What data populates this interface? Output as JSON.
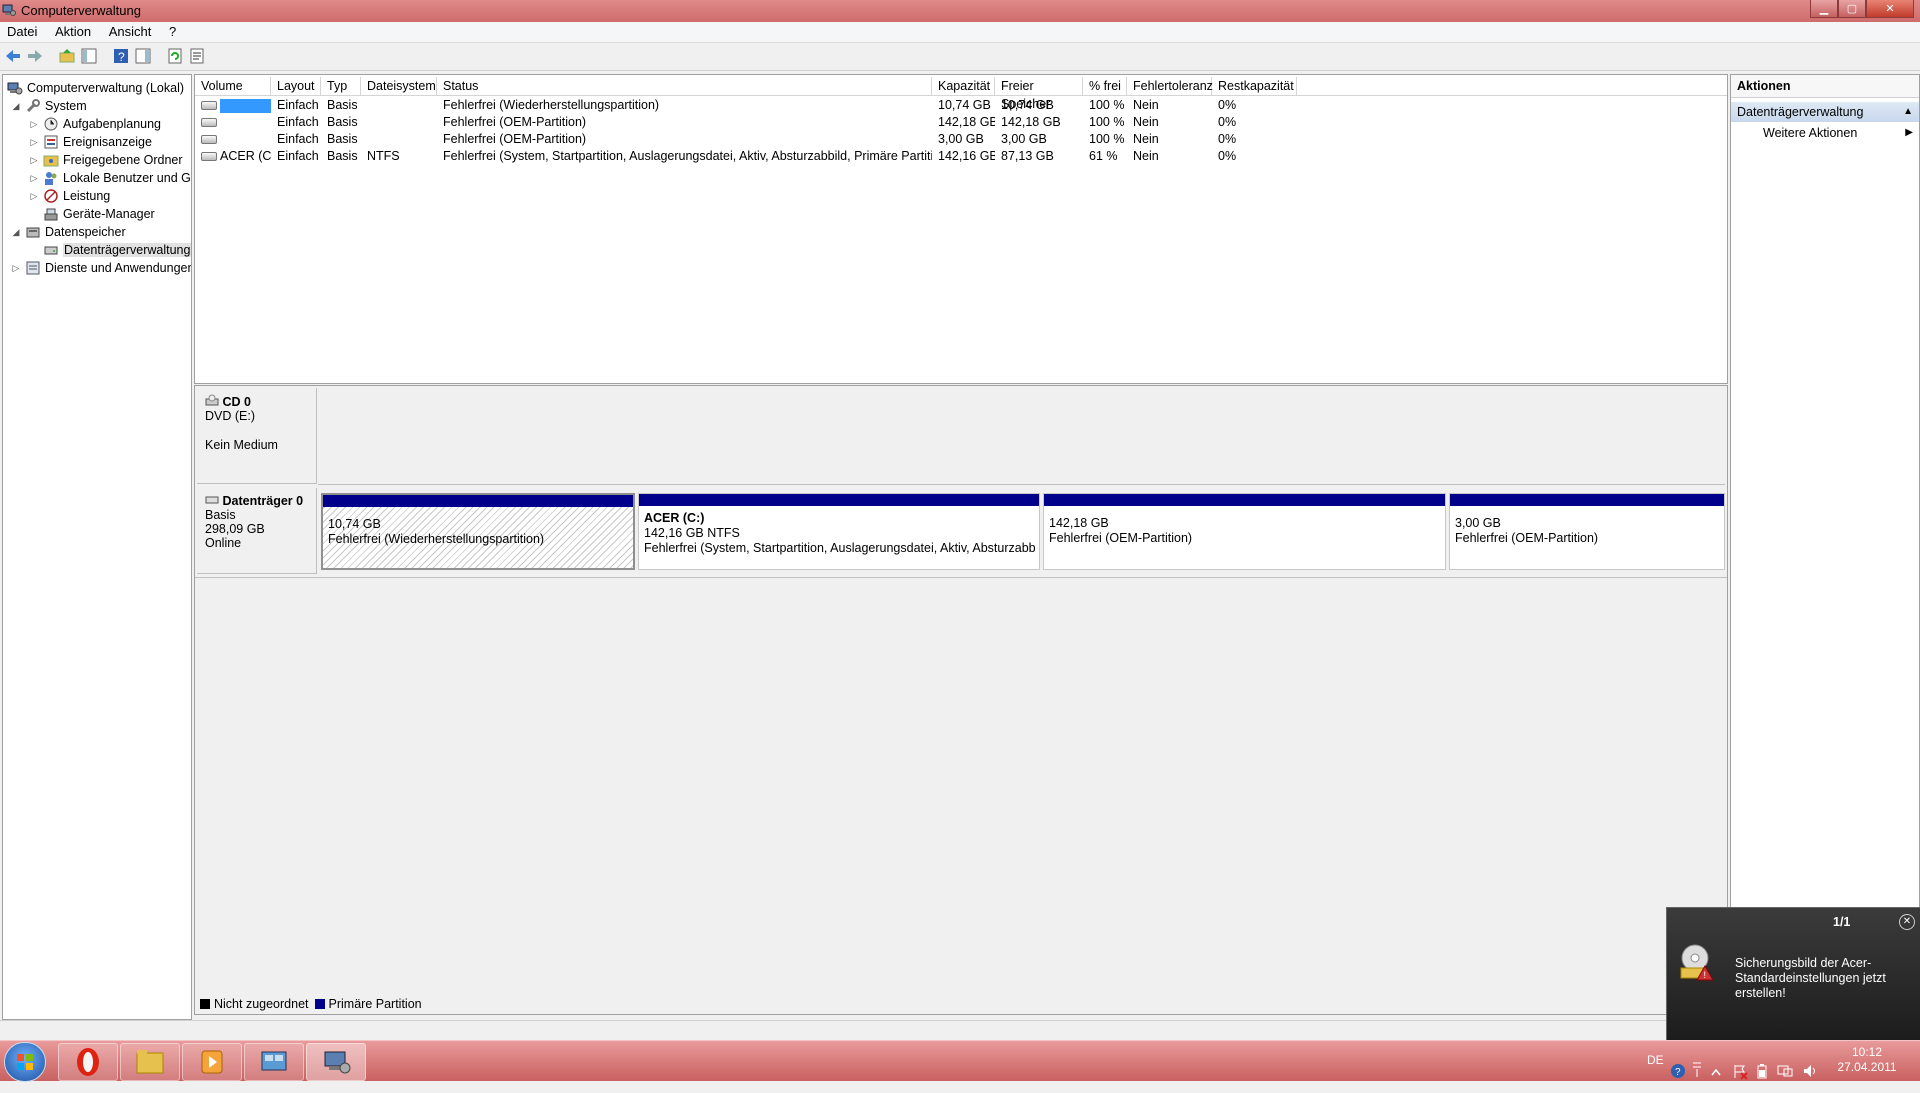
{
  "window": {
    "title": "Computerverwaltung"
  },
  "menu": [
    "Datei",
    "Aktion",
    "Ansicht",
    "?"
  ],
  "tree": [
    {
      "label": "Computerverwaltung (Lokal)",
      "icon": "computer-icon",
      "level": 0,
      "expander": ""
    },
    {
      "label": "System",
      "icon": "tools-icon",
      "level": 1,
      "expander": "◢"
    },
    {
      "label": "Aufgabenplanung",
      "icon": "clock-icon",
      "level": 2,
      "expander": "▷"
    },
    {
      "label": "Ereignisanzeige",
      "icon": "event-viewer-icon",
      "level": 2,
      "expander": "▷"
    },
    {
      "label": "Freigegebene Ordner",
      "icon": "shared-folder-icon",
      "level": 2,
      "expander": "▷"
    },
    {
      "label": "Lokale Benutzer und Gr",
      "icon": "users-icon",
      "level": 2,
      "expander": "▷"
    },
    {
      "label": "Leistung",
      "icon": "performance-icon",
      "level": 2,
      "expander": "▷"
    },
    {
      "label": "Geräte-Manager",
      "icon": "device-manager-icon",
      "level": 2,
      "expander": ""
    },
    {
      "label": "Datenspeicher",
      "icon": "storage-icon",
      "level": 1,
      "expander": "◢"
    },
    {
      "label": "Datenträgerverwaltung",
      "icon": "disk-management-icon",
      "level": 2,
      "expander": "",
      "selected": true
    },
    {
      "label": "Dienste und Anwendungen",
      "icon": "services-icon",
      "level": 1,
      "expander": "▷"
    }
  ],
  "volume_columns": [
    "Volume",
    "Layout",
    "Typ",
    "Dateisystem",
    "Status",
    "Kapazität",
    "Freier Speicher",
    "% frei",
    "Fehlertoleranz",
    "Restkapazität"
  ],
  "volumes": [
    {
      "volume": "",
      "selected": true,
      "layout": "Einfach",
      "typ": "Basis",
      "fs": "",
      "status": "Fehlerfrei (Wiederherstellungspartition)",
      "cap": "10,74 GB",
      "free": "10,74 GB",
      "pct": "100 %",
      "ft": "Nein",
      "rest": "0%"
    },
    {
      "volume": "",
      "layout": "Einfach",
      "typ": "Basis",
      "fs": "",
      "status": "Fehlerfrei (OEM-Partition)",
      "cap": "142,18 GB",
      "free": "142,18 GB",
      "pct": "100 %",
      "ft": "Nein",
      "rest": "0%"
    },
    {
      "volume": "",
      "layout": "Einfach",
      "typ": "Basis",
      "fs": "",
      "status": "Fehlerfrei (OEM-Partition)",
      "cap": "3,00 GB",
      "free": "3,00 GB",
      "pct": "100 %",
      "ft": "Nein",
      "rest": "0%"
    },
    {
      "volume": "ACER (C:)",
      "layout": "Einfach",
      "typ": "Basis",
      "fs": "NTFS",
      "status": "Fehlerfrei (System, Startpartition, Auslagerungsdatei, Aktiv, Absturzabbild, Primäre Partition)",
      "cap": "142,16 GB",
      "free": "87,13 GB",
      "pct": "61 %",
      "ft": "Nein",
      "rest": "0%"
    }
  ],
  "cd0": {
    "name": "CD 0",
    "drive": "DVD (E:)",
    "medium": "Kein Medium"
  },
  "disk0": {
    "name": "Datenträger 0",
    "type": "Basis",
    "size": "298,09 GB",
    "state": "Online",
    "partitions": [
      {
        "title": "",
        "size": "10,74 GB",
        "status": "Fehlerfrei (Wiederherstellungspartition)",
        "hatched": true
      },
      {
        "title": "ACER  (C:)",
        "size": "142,16 GB NTFS",
        "status": "Fehlerfrei (System, Startpartition, Auslagerungsdatei, Aktiv, Absturzabbild,"
      },
      {
        "title": "",
        "size": "142,18 GB",
        "status": "Fehlerfrei (OEM-Partition)"
      },
      {
        "title": "",
        "size": "3,00 GB",
        "status": "Fehlerfrei (OEM-Partition)"
      }
    ]
  },
  "legend": {
    "unallocated": "Nicht zugeordnet",
    "primary": "Primäre Partition",
    "unallocated_color": "#000000",
    "primary_color": "#00008b"
  },
  "actions": {
    "header": "Aktionen",
    "section": "Datenträgerverwaltung",
    "more": "Weitere Aktionen"
  },
  "notification": {
    "count": "1/1",
    "message": "Sicherungsbild der Acer-Standardeinstellungen jetzt erstellen!"
  },
  "taskbar": {
    "lang": "DE",
    "time": "10:12",
    "date": "27.04.2011"
  }
}
